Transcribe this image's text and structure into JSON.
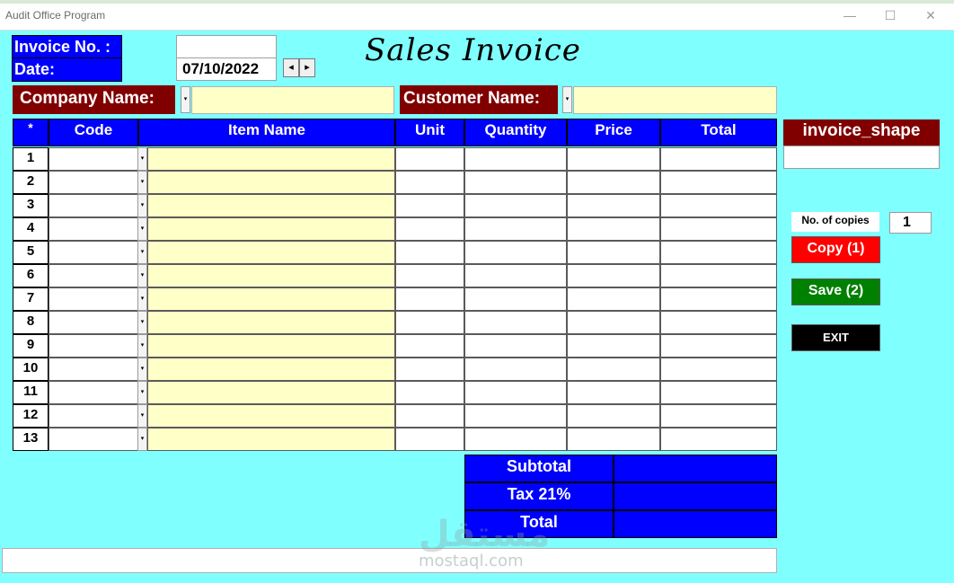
{
  "window": {
    "title": "Audit Office Program",
    "minimize": "—",
    "maximize": "☐",
    "close": "✕"
  },
  "header": {
    "invoice_no_label": "Invoice No. :",
    "date_label": "Date:",
    "invoice_no_value": "",
    "date_value": "07/10/2022",
    "prev": "◂",
    "next": "▸",
    "title": "Sales Invoice",
    "company_label": "Company Name:",
    "customer_label": "Customer Name:",
    "company_value": "",
    "customer_value": ""
  },
  "grid": {
    "columns": [
      "*",
      "Code",
      "Item Name",
      "Unit",
      "Quantity",
      "Price",
      "Total"
    ],
    "rows": [
      "1",
      "2",
      "3",
      "4",
      "5",
      "6",
      "7",
      "8",
      "9",
      "10",
      "11",
      "12",
      "13"
    ]
  },
  "side": {
    "invoice_shape_label": "invoice_shape",
    "invoice_shape_value": "",
    "copies_label": "No. of copies",
    "copies_value": "1",
    "copy_button": "Copy (1)",
    "save_button": "Save (2)",
    "exit_button": "EXIT"
  },
  "summary": {
    "subtotal_label": "Subtotal",
    "tax_label": "Tax 21%",
    "total_label": "Total"
  },
  "watermark": {
    "arabic": "مستقل",
    "latin": "mostaql.com"
  },
  "colors": {
    "background": "#80ffff",
    "header_blue": "#0000ff",
    "label_maroon": "#800000",
    "input_yellow": "#ffffc8",
    "copy_red": "#ff0000",
    "save_green": "#008000"
  }
}
